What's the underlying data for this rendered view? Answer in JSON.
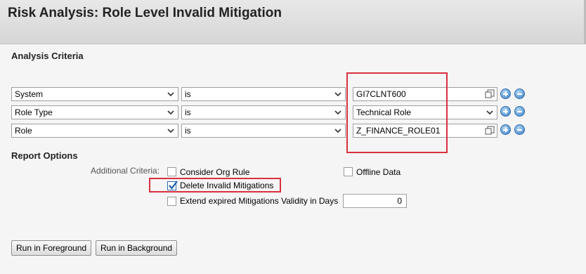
{
  "page": {
    "title": "Risk Analysis: Role Level Invalid Mitigation"
  },
  "analysis_criteria": {
    "title": "Analysis Criteria",
    "rows": [
      {
        "field": "System",
        "operator": "is",
        "value": "GI7CLNT600",
        "value_control": "value-help"
      },
      {
        "field": "Role Type",
        "operator": "is",
        "value": "Technical Role",
        "value_control": "dropdown"
      },
      {
        "field": "Role",
        "operator": "is",
        "value": "Z_FINANCE_ROLE01",
        "value_control": "value-help"
      }
    ]
  },
  "report_options": {
    "title": "Report Options",
    "additional_criteria_label": "Additional Criteria:",
    "consider_org_rule": {
      "label": "Consider Org Rule",
      "checked": false
    },
    "offline_data": {
      "label": "Offline Data",
      "checked": false
    },
    "delete_invalid_mitigations": {
      "label": "Delete Invalid Mitigations",
      "checked": true
    },
    "extend_expired": {
      "label": "Extend expired Mitigations Validity in Days",
      "checked": false,
      "days": "0"
    }
  },
  "buttons": {
    "run_foreground": "Run in Foreground",
    "run_background": "Run in Background"
  },
  "colors": {
    "highlight": "#d9303e",
    "accent": "#2e6fae"
  }
}
